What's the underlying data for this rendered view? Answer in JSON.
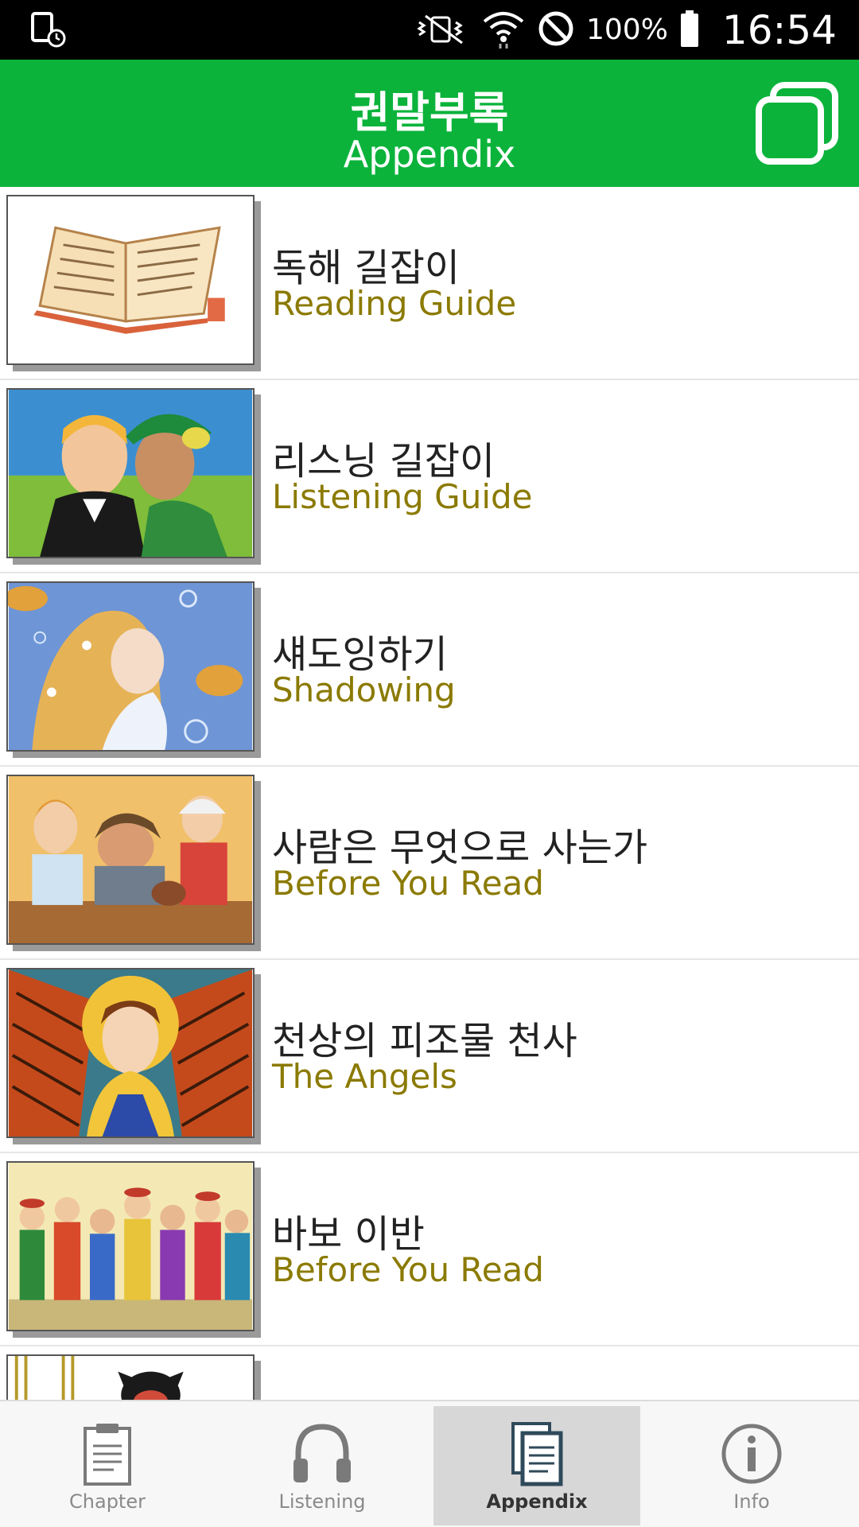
{
  "status_bar": {
    "battery_percent": "100%",
    "time": "16:54",
    "icons": [
      "screenshot-clock-icon",
      "vibrate-mute-icon",
      "wifi-icon",
      "do-not-disturb-icon",
      "battery-icon"
    ]
  },
  "app_bar": {
    "title_ko": "권말부록",
    "title_en": "Appendix",
    "action_icon": "copy-icon"
  },
  "list": {
    "items": [
      {
        "title_ko": "독해 길잡이",
        "title_en": "Reading Guide",
        "thumb": "open-book"
      },
      {
        "title_ko": "리스닝 길잡이",
        "title_en": "Listening Guide",
        "thumb": "two-boys"
      },
      {
        "title_ko": "섀도잉하기",
        "title_en": "Shadowing",
        "thumb": "mermaid"
      },
      {
        "title_ko": "사람은 무엇으로 사는가",
        "title_en": "Before You Read",
        "thumb": "shoemaker"
      },
      {
        "title_ko": "천상의 피조물 천사",
        "title_en": "The Angels",
        "thumb": "stained-glass-angel"
      },
      {
        "title_ko": "바보 이반",
        "title_en": "Before You Read",
        "thumb": "crowd-of-villagers"
      }
    ]
  },
  "bottom_nav": {
    "tabs": [
      {
        "label": "Chapter",
        "icon": "clipboard-icon",
        "active": false
      },
      {
        "label": "Listening",
        "icon": "headphones-icon",
        "active": false
      },
      {
        "label": "Appendix",
        "icon": "documents-icon",
        "active": true
      },
      {
        "label": "Info",
        "icon": "info-icon",
        "active": false
      }
    ]
  },
  "colors": {
    "app_bar": "#0bb33b",
    "subtitle": "#8b7a00",
    "status_bar": "#000000"
  }
}
